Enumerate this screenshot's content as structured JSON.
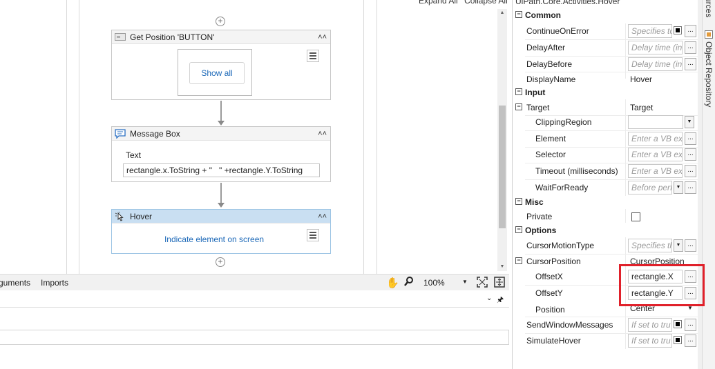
{
  "toolbar": {
    "expand_all": "Expand All",
    "collapse_all": "Collapse All"
  },
  "workflow": {
    "get_position": {
      "title": "Get Position 'BUTTON'",
      "show_all": "Show all"
    },
    "message_box": {
      "title": "Message Box",
      "text_label": "Text",
      "text_value": "rectangle.x.ToString + \"   \" +rectangle.Y.ToString"
    },
    "hover": {
      "title": "Hover",
      "indicate": "Indicate element on screen"
    }
  },
  "bottom_bar": {
    "tab_arguments": "guments",
    "tab_imports": "Imports",
    "zoom": "100%"
  },
  "properties": {
    "title": "UiPath.Core.Activities.Hover",
    "common": {
      "label": "Common",
      "continue_on_error": {
        "name": "ContinueOnError",
        "placeholder": "Specifies tc"
      },
      "delay_after": {
        "name": "DelayAfter",
        "placeholder": "Delay time (in"
      },
      "delay_before": {
        "name": "DelayBefore",
        "placeholder": "Delay time (in"
      },
      "display_name": {
        "name": "DisplayName",
        "value": "Hover"
      }
    },
    "input": {
      "label": "Input",
      "target": {
        "name": "Target",
        "value": "Target"
      },
      "clipping_region": {
        "name": "ClippingRegion"
      },
      "element": {
        "name": "Element",
        "placeholder": "Enter a VB exp"
      },
      "selector": {
        "name": "Selector",
        "placeholder": "Enter a VB exp"
      },
      "timeout": {
        "name": "Timeout (milliseconds)",
        "placeholder": "Enter a VB exp"
      },
      "wait_for_ready": {
        "name": "WaitForReady",
        "placeholder": "Before perf"
      }
    },
    "misc": {
      "label": "Misc",
      "private": {
        "name": "Private"
      }
    },
    "options": {
      "label": "Options",
      "cursor_motion_type": {
        "name": "CursorMotionType",
        "placeholder": "Specifies th"
      },
      "cursor_position": {
        "name": "CursorPosition",
        "value": "CursorPosition"
      },
      "offset_x": {
        "name": "OffsetX",
        "value": "rectangle.X"
      },
      "offset_y": {
        "name": "OffsetY",
        "value": "rectangle.Y"
      },
      "position": {
        "name": "Position",
        "value": "Center"
      },
      "send_window_messages": {
        "name": "SendWindowMessages",
        "placeholder": "If set to tru"
      },
      "simulate_hover": {
        "name": "SimulateHover",
        "placeholder": "If set to tru"
      }
    }
  },
  "side_tabs": {
    "resources": "urces",
    "object_repository": "Object Repository"
  },
  "colors": {
    "highlight": "#e0202a",
    "selected_header": "#c9dff2",
    "link": "#1d69b8"
  }
}
